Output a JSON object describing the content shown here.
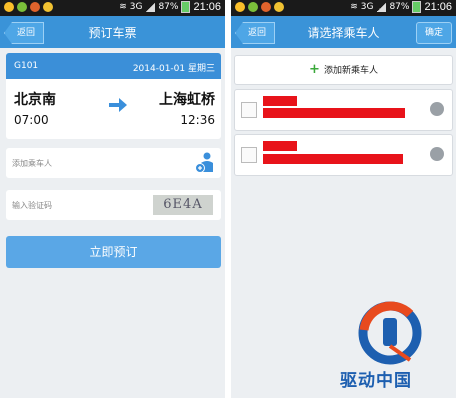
{
  "status": {
    "left_time": "21:06",
    "right_time": "21:06",
    "left_battery": "87%",
    "right_battery": "87%",
    "network": "3G"
  },
  "left": {
    "back_label": "返回",
    "title": "预订车票",
    "train_no": "G101",
    "date": "2014-01-01 星期三",
    "from_station": "北京南",
    "to_station": "上海虹桥",
    "depart_time": "07:00",
    "arrive_time": "12:36",
    "add_passenger_label": "添加乘车人",
    "captcha_placeholder": "输入验证码",
    "captcha_text": "6E4A",
    "book_button": "立即预订"
  },
  "right": {
    "back_label": "返回",
    "title": "请选择乘车人",
    "confirm_label": "确定",
    "add_new_label": "添加新乘车人"
  },
  "watermark": {
    "text": "驱动中国"
  },
  "colors": {
    "header": "#3a93d8",
    "primary": "#5aa7e6",
    "redaction": "#e8131a"
  }
}
